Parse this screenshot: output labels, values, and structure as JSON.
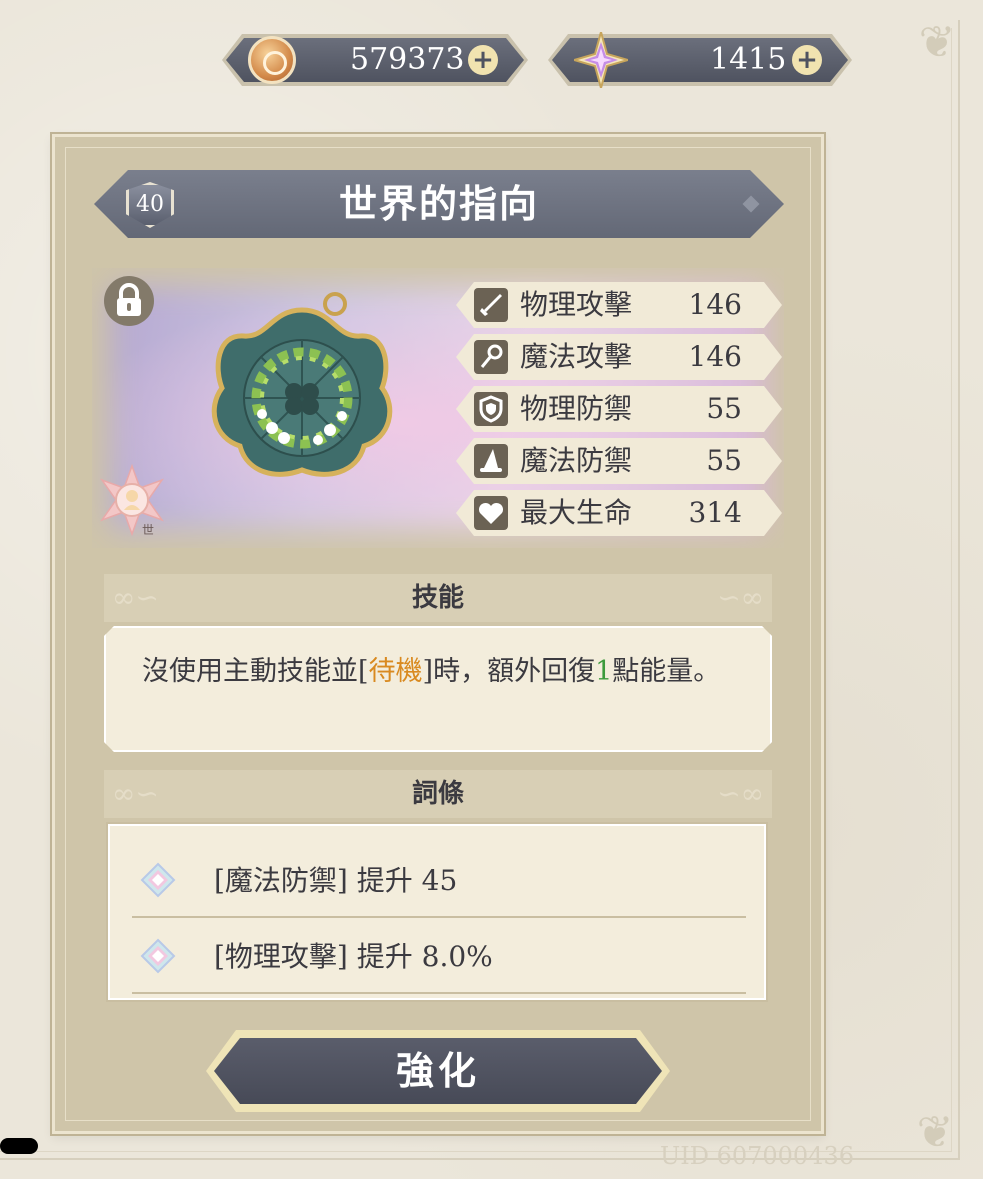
{
  "currency": {
    "gold": {
      "icon": "gold-coin-icon",
      "value": "579373"
    },
    "gems": {
      "icon": "star-gem-icon",
      "value": "1415"
    }
  },
  "item": {
    "level": "40",
    "name": "世界的指向",
    "locked": true,
    "trait_icon": "world-trait-icon",
    "stats": [
      {
        "icon": "sword-icon",
        "name": "物理攻擊",
        "value": "146"
      },
      {
        "icon": "staff-icon",
        "name": "魔法攻擊",
        "value": "146"
      },
      {
        "icon": "shield-icon",
        "name": "物理防禦",
        "value": "55"
      },
      {
        "icon": "wizard-hat-icon",
        "name": "魔法防禦",
        "value": "55"
      },
      {
        "icon": "heart-icon",
        "name": "最大生命",
        "value": "314"
      }
    ]
  },
  "skill": {
    "header": "技能",
    "text_parts": {
      "a": "沒使用主動技能並[",
      "kw1": "待機",
      "b": "]時，額外回復",
      "kw2": "1",
      "c": "點能量。"
    }
  },
  "affixes": {
    "header": "詞條",
    "items": [
      {
        "icon": "affix-gem-icon",
        "text": "[魔法防禦] 提升 45"
      },
      {
        "icon": "affix-gem-icon",
        "text": "[物理攻擊] 提升 8.0%"
      }
    ]
  },
  "button": {
    "enhance": "強化"
  },
  "footer": {
    "uid": "UID 607000436"
  },
  "colors": {
    "panel": "#cfc5a9",
    "banner": "#6e7381",
    "keyword_orange": "#d98a20",
    "keyword_green": "#3c9a3c"
  }
}
